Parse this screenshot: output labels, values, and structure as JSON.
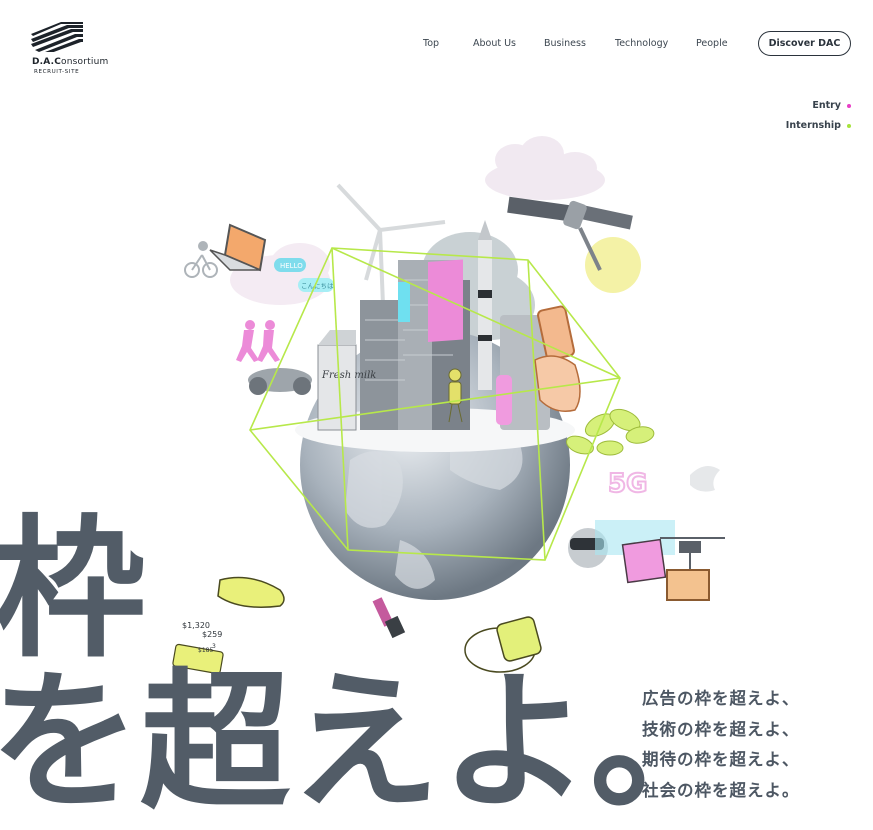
{
  "brand": {
    "name_bold": "D.A.C",
    "name_rest": "onsortium",
    "sub": "RECRUIT-SITE"
  },
  "nav": {
    "items": [
      {
        "label": "Top"
      },
      {
        "label": "About Us"
      },
      {
        "label": "Business"
      },
      {
        "label": "Technology"
      },
      {
        "label": "People"
      }
    ],
    "discover_label": "Discover DAC"
  },
  "side_links": {
    "entry": {
      "label": "Entry",
      "dot_color": "#e83ec6"
    },
    "internship": {
      "label": "Internship",
      "dot_color": "#a6e33c"
    }
  },
  "illustration": {
    "bubble_hello": "HELLO",
    "bubble_konnichiwa": "こんにちは",
    "milk_label": "Fresh milk",
    "label_5g": "5G",
    "price_1": "$1,320",
    "price_2": "$259",
    "price_3": "$185",
    "price_4": "3"
  },
  "hero": {
    "line1": "枠",
    "line2": "を超えよ。"
  },
  "tagline": [
    "広告の枠を超えよ、",
    "技術の枠を超えよ、",
    "期待の枠を超えよ、",
    "社会の枠を超えよ。"
  ],
  "colors": {
    "text": "#525c67",
    "accent_pink": "#e83ec6",
    "accent_green": "#a6e33c",
    "wireframe": "#b7e84a"
  }
}
